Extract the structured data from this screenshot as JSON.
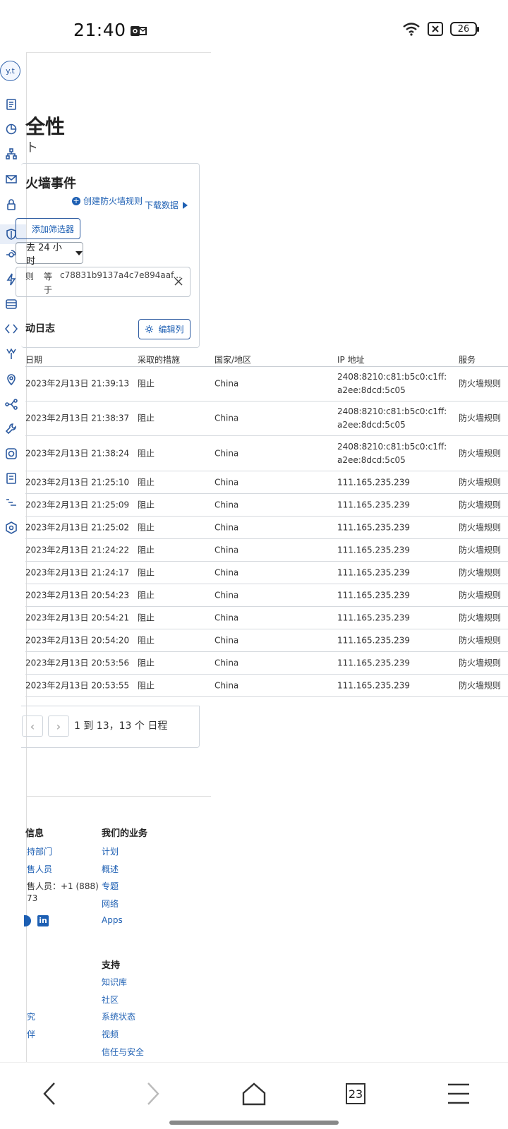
{
  "status_bar": {
    "time": "21:40",
    "battery": "26"
  },
  "avatar": {
    "initials": "y.t"
  },
  "section": {
    "title": "全性",
    "subtitle": "ト"
  },
  "card": {
    "title": "火墙事件",
    "create_rule": "创建防火墙规则",
    "download": "下载数据",
    "add_filter": "添加筛选器",
    "time_range": "去 24 小时",
    "filter": {
      "field": "则",
      "operator": "等于",
      "value": "c78831b9137a4c7e894aaf..."
    },
    "log_title": "动日志",
    "edit_columns": "编辑列"
  },
  "table": {
    "headers": {
      "date": "日期",
      "action": "采取的措施",
      "country": "国家/地区",
      "ip": "IP 地址",
      "service": "服务"
    },
    "rows": [
      {
        "date": "2023年2月13日 21:39:13",
        "action": "阻止",
        "country": "China",
        "ip": "2408:8210:c81:b5c0:c1ff:a2ee:8dcd:5c05",
        "service": "防火墙规则"
      },
      {
        "date": "2023年2月13日 21:38:37",
        "action": "阻止",
        "country": "China",
        "ip": "2408:8210:c81:b5c0:c1ff:a2ee:8dcd:5c05",
        "service": "防火墙规则"
      },
      {
        "date": "2023年2月13日 21:38:24",
        "action": "阻止",
        "country": "China",
        "ip": "2408:8210:c81:b5c0:c1ff:a2ee:8dcd:5c05",
        "service": "防火墙规则"
      },
      {
        "date": "2023年2月13日 21:25:10",
        "action": "阻止",
        "country": "China",
        "ip": "111.165.235.239",
        "service": "防火墙规则"
      },
      {
        "date": "2023年2月13日 21:25:09",
        "action": "阻止",
        "country": "China",
        "ip": "111.165.235.239",
        "service": "防火墙规则"
      },
      {
        "date": "2023年2月13日 21:25:02",
        "action": "阻止",
        "country": "China",
        "ip": "111.165.235.239",
        "service": "防火墙规则"
      },
      {
        "date": "2023年2月13日 21:24:22",
        "action": "阻止",
        "country": "China",
        "ip": "111.165.235.239",
        "service": "防火墙规则"
      },
      {
        "date": "2023年2月13日 21:24:17",
        "action": "阻止",
        "country": "China",
        "ip": "111.165.235.239",
        "service": "防火墙规则"
      },
      {
        "date": "2023年2月13日 20:54:23",
        "action": "阻止",
        "country": "China",
        "ip": "111.165.235.239",
        "service": "防火墙规则"
      },
      {
        "date": "2023年2月13日 20:54:21",
        "action": "阻止",
        "country": "China",
        "ip": "111.165.235.239",
        "service": "防火墙规则"
      },
      {
        "date": "2023年2月13日 20:54:20",
        "action": "阻止",
        "country": "China",
        "ip": "111.165.235.239",
        "service": "防火墙规则"
      },
      {
        "date": "2023年2月13日 20:53:56",
        "action": "阻止",
        "country": "China",
        "ip": "111.165.235.239",
        "service": "防火墙规则"
      },
      {
        "date": "2023年2月13日 20:53:55",
        "action": "阻止",
        "country": "China",
        "ip": "111.165.235.239",
        "service": "防火墙规则"
      }
    ]
  },
  "pagination": {
    "prev": "‹",
    "next": "›",
    "range": "1 到 13，13 个 日程"
  },
  "footer": {
    "col1": {
      "heading": "信息",
      "links": [
        "持部门",
        "售人员"
      ],
      "phone": "售人员：+1 (888)",
      "phone2": "73",
      "research": "究",
      "partners": "伴"
    },
    "col2": {
      "heading": "我们的业务",
      "links": [
        "计划",
        "概述",
        "专题",
        "网络",
        "Apps"
      ]
    },
    "col3": {
      "heading": "支持",
      "links": [
        "知识库",
        "社区",
        "系统状态",
        "视频",
        "信任与安全"
      ]
    }
  },
  "nav": {
    "tabs_count": "23"
  },
  "colors": {
    "accent": "#1d5fb3",
    "border": "#cfd5dc"
  }
}
